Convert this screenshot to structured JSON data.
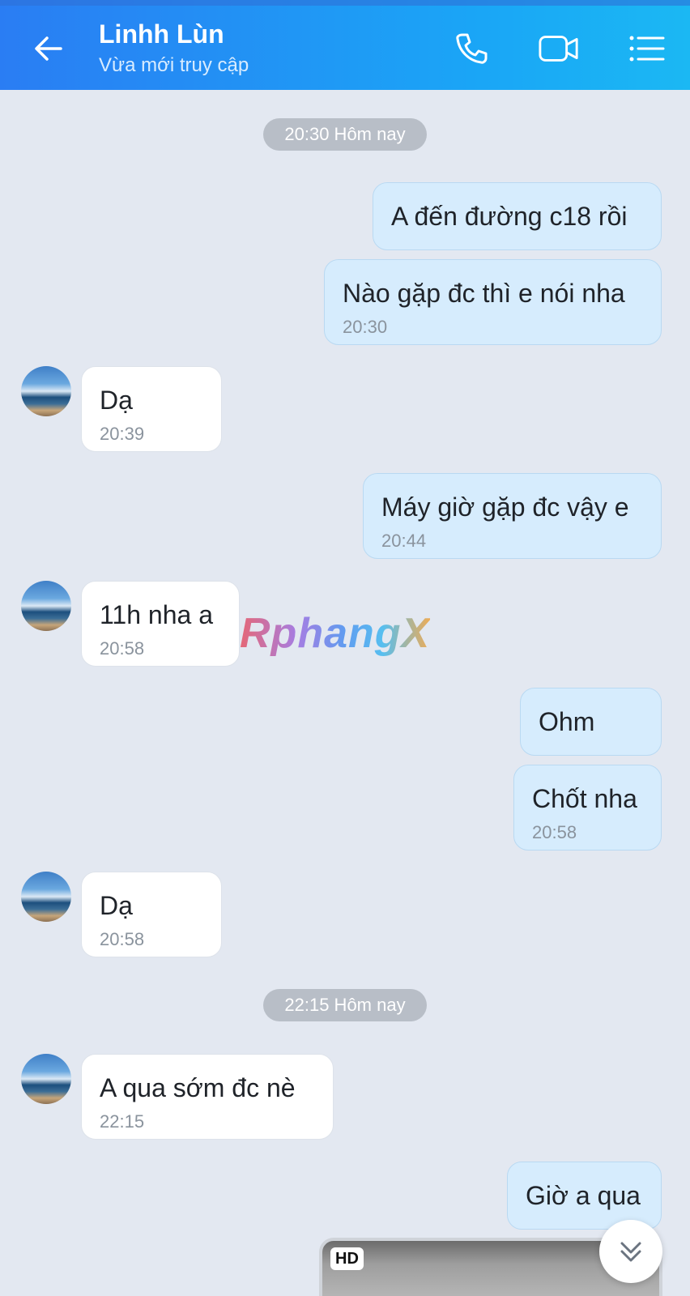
{
  "header": {
    "contact_name": "Linhh Lùn",
    "status": "Vừa mới truy cập"
  },
  "separators": [
    {
      "label": "20:30 Hôm nay"
    },
    {
      "label": "22:15 Hôm nay"
    }
  ],
  "messages": [
    {
      "direction": "out",
      "text": "A đến đường c18 rồi",
      "time": ""
    },
    {
      "direction": "out",
      "text": "Nào gặp đc thì e nói nha",
      "time": "20:30"
    },
    {
      "direction": "in",
      "text": "Dạ",
      "time": "20:39"
    },
    {
      "direction": "out",
      "text": "Máy giờ gặp đc vậy e",
      "time": "20:44"
    },
    {
      "direction": "in",
      "text": "11h nha a",
      "time": "20:58"
    },
    {
      "direction": "out",
      "text": "Ohm",
      "time": ""
    },
    {
      "direction": "out",
      "text": "Chốt nha",
      "time": "20:58"
    },
    {
      "direction": "in",
      "text": "Dạ",
      "time": "20:58"
    },
    {
      "direction": "in",
      "text": "A qua sớm đc nè",
      "time": "22:15"
    },
    {
      "direction": "out",
      "text": "Giờ a qua",
      "time": ""
    }
  ],
  "media": {
    "badge": "HD"
  },
  "watermark": "RphangX",
  "icons": {
    "back": "arrow-left-icon",
    "call": "phone-icon",
    "video": "video-camera-icon",
    "menu": "list-menu-icon",
    "scroll": "chevron-double-down-icon"
  },
  "colors": {
    "header_start": "#2a7df3",
    "header_end": "#1bb8f3",
    "outgoing_bubble": "#d6ecfd",
    "incoming_bubble": "#ffffff",
    "chat_background": "#e3e8f1"
  }
}
